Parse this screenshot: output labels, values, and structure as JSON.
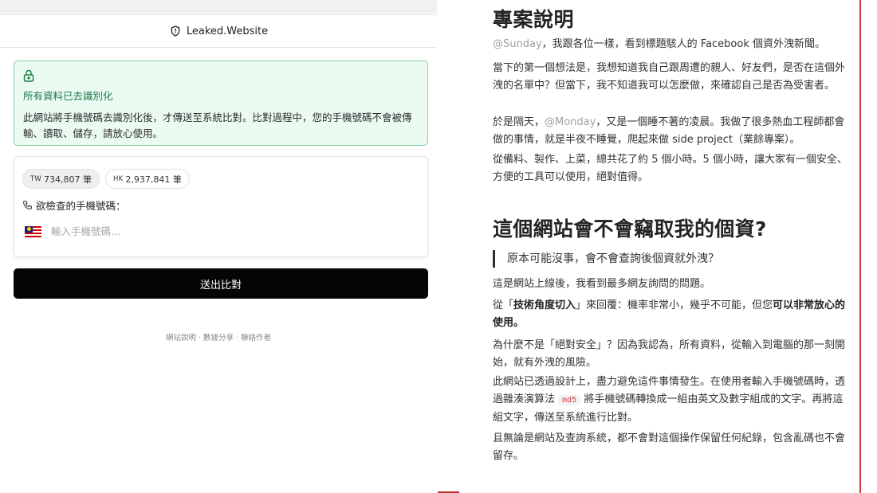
{
  "left": {
    "site_name": "Leaked.Website",
    "privacy": {
      "title": "所有資料已去識別化",
      "text": "此網站將手機號碼去識別化後，才傳送至系統比對。比對過程中，您的手機號碼不會被傳輸、讀取、儲存，請放心使用。"
    },
    "badges": [
      {
        "code": "TW",
        "count": "734,807 筆"
      },
      {
        "code": "HK",
        "count": "2,937,841 筆"
      }
    ],
    "phone_label": "欲檢查的手機號碼：",
    "phone_placeholder": "輸入手機號碼...",
    "phone_value": "",
    "submit_label": "送出比對",
    "footer": "網站說明 · 數據分享 · 聯絡作者"
  },
  "right": {
    "heading1": "專案說明",
    "p1_mention": "@Sunday",
    "p1_text": "，我跟各位一樣，看到標題駭人的 Facebook 個資外洩新聞。",
    "p2": "當下的第一個想法是，我想知道我自己跟周遭的親人、好友們，是否在這個外洩的名單中？但當下，我不知道我可以怎麼做，來確認自己是否為受害者。",
    "p3_pre": "於是隔天，",
    "p3_mention": "@Monday",
    "p3_text": "，又是一個睡不著的凌晨。我做了很多熱血工程師都會做的事情，就是半夜不睡覺，爬起來做 side project（業餘專案）。",
    "p4": "從備料、製作、上菜，總共花了約 5 個小時。5 個小時，讓大家有一個安全、方便的工具可以使用，絕對值得。",
    "heading2": "這個網站會不會竊取我的個資?",
    "quote": "原本可能沒事，會不會查詢後個資就外洩？",
    "p5": "這是網站上線後，我看到最多網友詢問的問題。",
    "p6_pre": "從「",
    "p6_bold1": "技術角度切入",
    "p6_mid": "」來回覆：機率非常小，幾乎不可能，但您",
    "p6_bold2": "可以非常放心的使用。",
    "p7": "為什麼不是「絕對安全」？因為我認為，所有資料，從輸入到電腦的那一刻開始，就有外洩的風險。",
    "p8_pre": "此網站已透過設計上，盡力避免這件事情發生。在使用者輸入手機號碼時，透過雜湊演算法 ",
    "p8_code": "md5",
    "p8_post": " 將手機號碼轉換成一組由英文及數字組成的文字。再將這組文字，傳送至系統進行比對。",
    "p9": "且無論是網站及查詢系統，都不會對這個操作保留任何紀錄，包含亂碼也不會留存。"
  },
  "colors": {
    "privacy_bg": "#ecfbf2",
    "privacy_border": "#7fcf9f",
    "privacy_title": "#187a45",
    "button_bg": "#050505",
    "accent_red": "#cf3a3a"
  }
}
